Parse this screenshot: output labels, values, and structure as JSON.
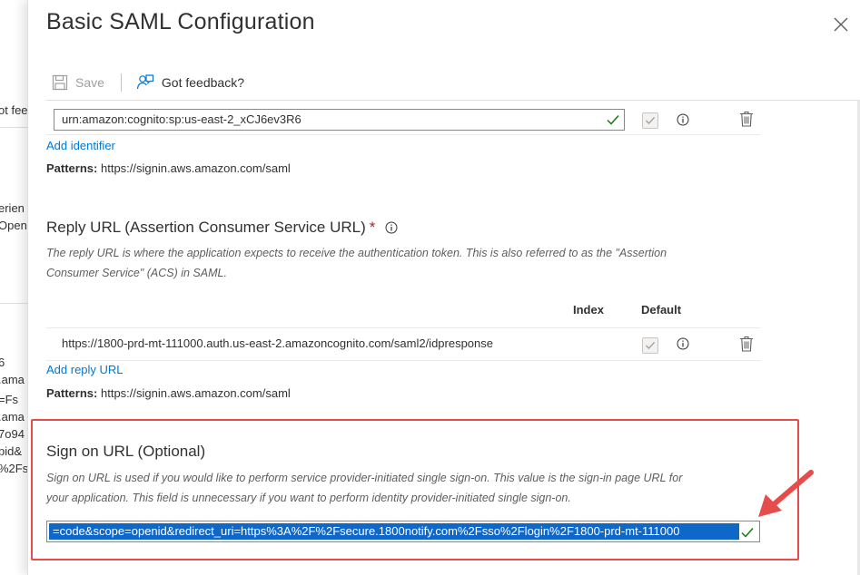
{
  "background_fragments": {
    "f1": "ot fee",
    "f2": "erien",
    "f3": "Open",
    "f4": "6",
    "f5": ".ama",
    "f6": "=Fs",
    "f7": ".ama",
    "f8": "7o94",
    "f9": "pid&",
    "f10": "%2Fs"
  },
  "panel": {
    "title": "Basic SAML Configuration"
  },
  "toolbar": {
    "save_label": "Save",
    "feedback_label": "Got feedback?"
  },
  "identifier": {
    "value": "urn:amazon:cognito:sp:us-east-2_xCJ6ev3R6",
    "add_label": "Add identifier",
    "patterns_label": "Patterns:",
    "patterns_value": "https://signin.aws.amazon.com/saml"
  },
  "reply_url": {
    "title": "Reply URL (Assertion Consumer Service URL)",
    "required_mark": "*",
    "description_line1": "The reply URL is where the application expects to receive the authentication token. This is also referred to as the \"Assertion",
    "description_line2": "Consumer Service\" (ACS) in SAML.",
    "col_index": "Index",
    "col_default": "Default",
    "row_value": "https://1800-prd-mt-111000.auth.us-east-2.amazoncognito.com/saml2/idpresponse",
    "add_label": "Add reply URL",
    "patterns_label": "Patterns:",
    "patterns_value": "https://signin.aws.amazon.com/saml"
  },
  "sign_on": {
    "title": "Sign on URL (Optional)",
    "description_line1": "Sign on URL is used if you would like to perform service provider-initiated single sign-on. This value is the sign-in page URL for",
    "description_line2": "your application. This field is unnecessary if you want to perform identity provider-initiated single sign-on.",
    "value": "=code&scope=openid&redirect_uri=https%3A%2F%2Fsecure.1800notify.com%2Fsso%2Flogin%2F1800-prd-mt-111000"
  },
  "colors": {
    "accent": "#0078d4",
    "valid_check": "#107c10",
    "highlight_border": "#e64c4c",
    "selection": "#0f67c8"
  }
}
